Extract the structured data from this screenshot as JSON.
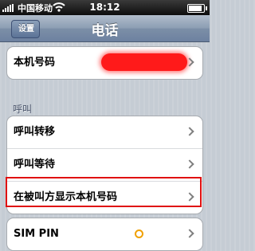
{
  "status_bar": {
    "carrier": "中国移动",
    "time": "18:12",
    "battery_level": 0.9,
    "signal_bars": 5
  },
  "nav_bar": {
    "back_label": "设置",
    "title": "电话"
  },
  "groups": {
    "my_number": {
      "label": "本机号码",
      "value_redacted": true
    },
    "calls": {
      "header": "呼叫",
      "items": [
        {
          "label": "呼叫转移"
        },
        {
          "label": "呼叫等待"
        },
        {
          "label": "在被叫方显示本机号码",
          "highlighted": true
        }
      ]
    },
    "sim": {
      "label": "SIM PIN"
    }
  },
  "colors": {
    "background": "#c5ccd4",
    "nav_bar": "#8b9db3",
    "highlight_border": "#e01010",
    "redaction": "#ff1a1a"
  },
  "icons": [
    "signal-icon",
    "wifi-icon",
    "battery-icon",
    "chevron-right-icon"
  ]
}
